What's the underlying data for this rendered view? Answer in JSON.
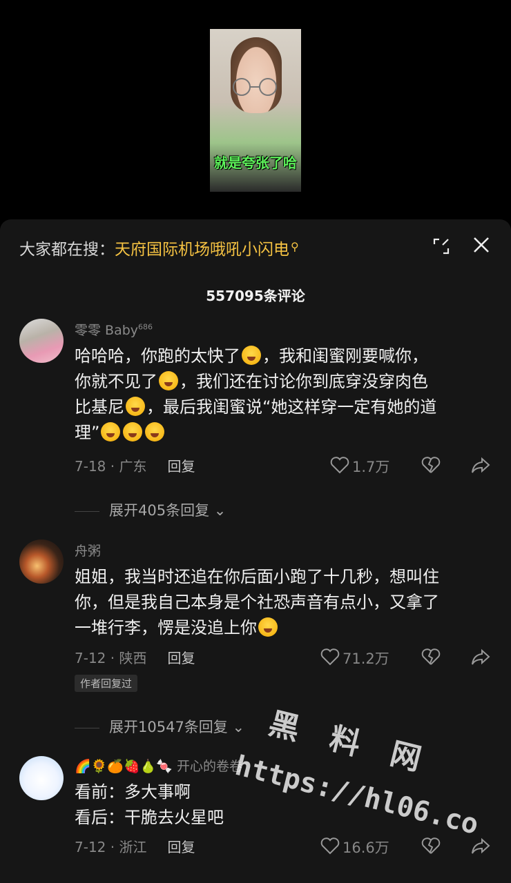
{
  "video": {
    "caption": "就是夸张了哈"
  },
  "search": {
    "prefix": "大家都在搜：",
    "term": "天府国际机场哦吼小闪电",
    "icon": "search-icon"
  },
  "header": {
    "count_label": "557095条评论",
    "expand_icon": "expand-icon",
    "close_icon": "close-icon"
  },
  "comments": [
    {
      "author": "零零 Baby",
      "author_sup": "686",
      "body": [
        "哈哈哈，你跑的太快了",
        "，我和闺蜜刚要喊你，",
        "你就不见了",
        "，我们还在讨论你到底穿没穿肉色",
        "比基尼",
        "，最后我闺蜜说“她这样穿一定有她的道",
        "理”"
      ],
      "date_region": "7-18 · 广东",
      "reply_label": "回复",
      "likes": "1.7万",
      "expand_label": "展开405条回复"
    },
    {
      "author": "舟粥",
      "body": [
        "姐姐，我当时还追在你后面小跑了十几秒，想叫住",
        "你，但是我自己本身是个社恐声音有点小，又拿了",
        "一堆行李，愣是没追上你"
      ],
      "date_region": "7-12 · 陕西",
      "reply_label": "回复",
      "likes": "71.2万",
      "tag": "作者回复过",
      "expand_label": "展开10547条回复"
    },
    {
      "author_emojis": "🌈🌻🍊🍓🍐🍬",
      "author": "开心的卷卷",
      "body": [
        "看前：多大事啊",
        "看后：干脆去火星吧"
      ],
      "date_region": "7-12 · 浙江",
      "reply_label": "回复",
      "likes": "16.6万"
    }
  ],
  "watermark": {
    "line1": "黑 料 网",
    "line2": "https://hl06.co"
  }
}
